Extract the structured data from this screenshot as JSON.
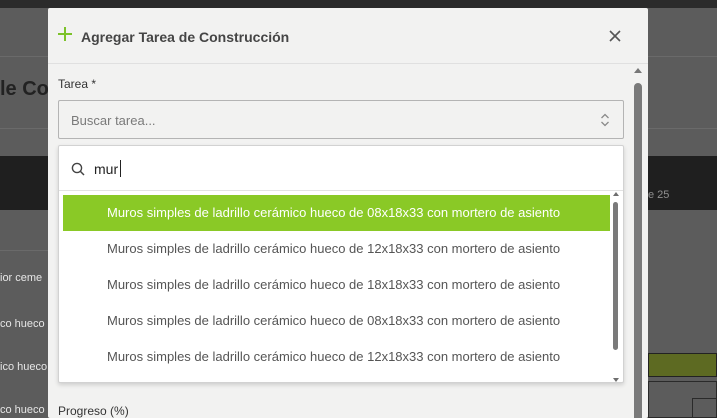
{
  "background": {
    "title_fragment": "le Co",
    "week_label": "e 25",
    "row_fragments": [
      "ior ceme",
      "co hueco",
      "ico hueco",
      "co hueco",
      "ico hueco"
    ]
  },
  "modal": {
    "title": "Agregar Tarea de Construcción",
    "accent_color": "#7cc22a",
    "tarea_label": "Tarea *",
    "select_placeholder": "Buscar tarea...",
    "search_value": "mur",
    "options": [
      "Muros simples de ladrillo cerámico hueco de 08x18x33 con mortero de asiento",
      "Muros simples de ladrillo cerámico hueco de 12x18x33 con mortero de asiento",
      "Muros simples de ladrillo cerámico hueco de 18x18x33 con mortero de asiento",
      "Muros simples de ladrillo cerámico hueco de 08x18x33 con mortero de asiento",
      "Muros simples de ladrillo cerámico hueco de 12x18x33 con mortero de asiento"
    ],
    "selected_index": 0,
    "selected_color": "#8ac926",
    "progress_label": "Progreso (%)"
  }
}
